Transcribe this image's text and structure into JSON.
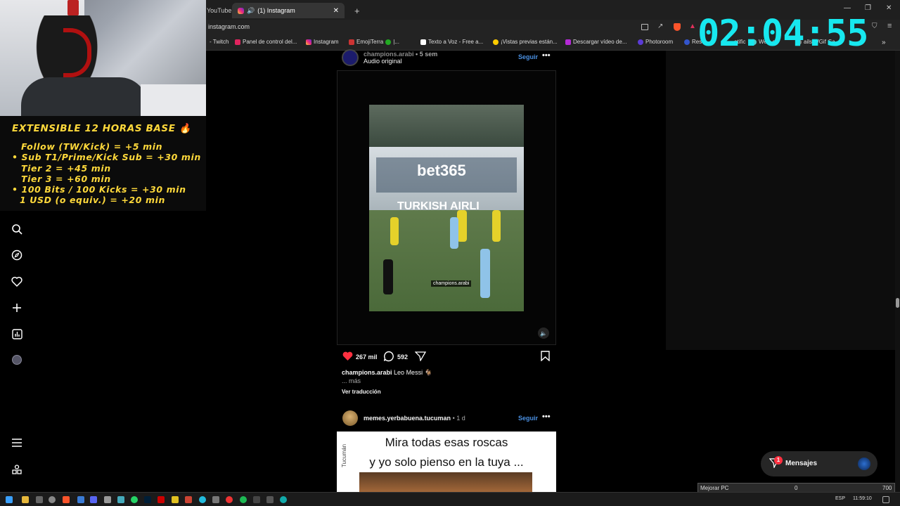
{
  "browser": {
    "tab_youtube": "YouTube",
    "tab_active": "(1) Instagram",
    "url": "instagram.com",
    "bookmarks": [
      "- Twitch",
      "Panel de control del...",
      "Instagram",
      "EmojiTerra",
      "|...",
      "Texto a Voz - Free a...",
      "¡Vistas previas están...",
      "Descargar vídeo de...",
      "Photoroom",
      "Res",
      "otific",
      "Web",
      "er",
      "ails",
      "e/Gif",
      "Sa"
    ]
  },
  "overlay": {
    "timer": "02:04:55",
    "info_lines": [
      "EXTENSIBLE 12 HORAS BASE 🔥",
      "Follow (TW/Kick) = +5 min",
      "• Sub T1/Prime/Kick Sub = +30 min",
      "Tier 2 = +45 min",
      "Tier 3 = +60 min",
      "• 100 Bits / 100 Kicks = +30 min",
      "1 USD (o equiv.) = +20 min"
    ]
  },
  "post1": {
    "username": "champions.arabi",
    "time": "• 5 sem",
    "audio": "Audio original",
    "follow": "Seguir",
    "watermark": "champions.arabi",
    "board_text": "bet365",
    "board_text2": "TURKISH AIRLI",
    "likes": "267 mil",
    "comments": "592",
    "caption_user": "champions.arabi",
    "caption_text": "Leo Messi 🐐",
    "more": "... más",
    "translate": "Ver traducción"
  },
  "post2": {
    "username": "memes.yerbabuena.tucuman",
    "time": "• 1 d",
    "follow": "Seguir",
    "image_line1": "Mira todas esas roscas",
    "image_line2": "y yo solo pienso en la tuya ...",
    "side_text": "Tucumán"
  },
  "messages": {
    "label": "Mensajes",
    "badge": "1"
  },
  "popup": {
    "label": "Mejorar PC",
    "value1": "0",
    "value2": "700"
  },
  "taskbar": {
    "lang": "ESP",
    "time": "11:59:10"
  }
}
